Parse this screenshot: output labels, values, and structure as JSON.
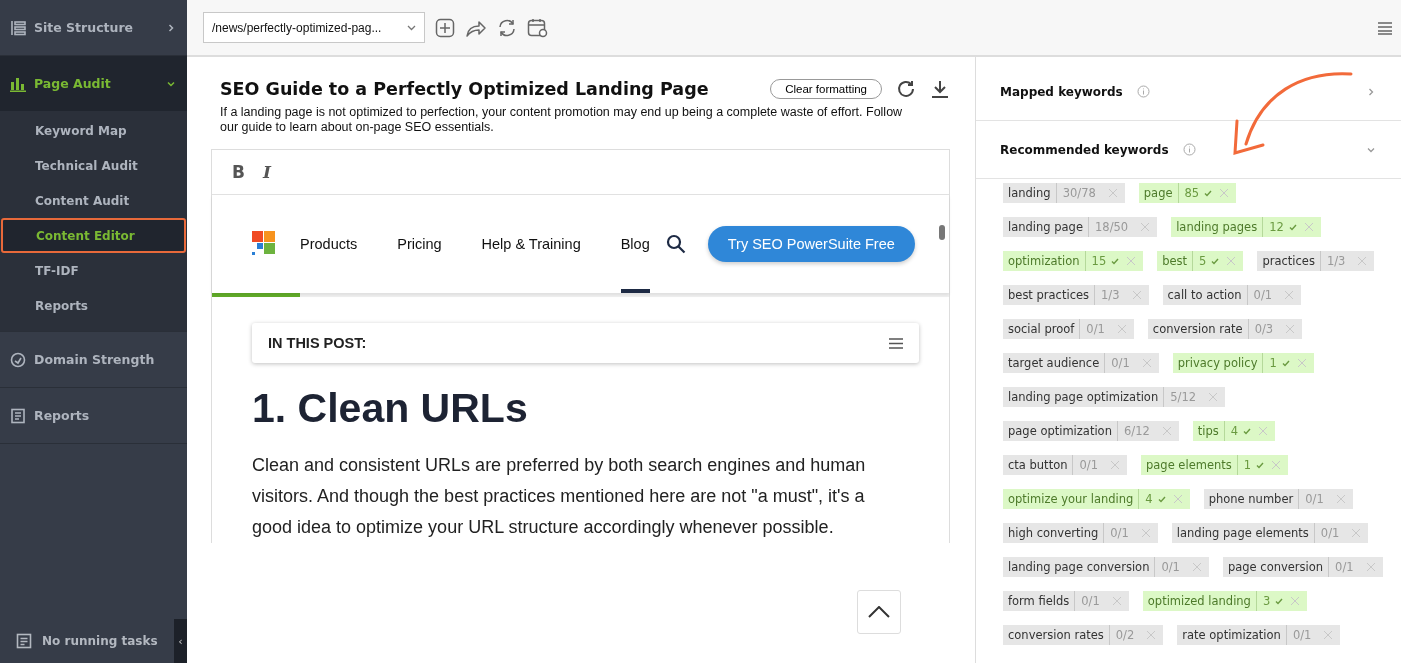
{
  "sidebar": {
    "sections": [
      {
        "label": "Site Structure",
        "expanded": false,
        "selected": false
      },
      {
        "label": "Page Audit",
        "expanded": true,
        "selected": true,
        "children": [
          {
            "label": "Keyword Map",
            "selected": false
          },
          {
            "label": "Technical Audit",
            "selected": false
          },
          {
            "label": "Content Audit",
            "selected": false
          },
          {
            "label": "Content Editor",
            "selected": true
          },
          {
            "label": "TF-IDF",
            "selected": false
          },
          {
            "label": "Reports",
            "selected": false
          }
        ]
      },
      {
        "label": "Domain Strength",
        "selected": false
      },
      {
        "label": "Reports",
        "selected": false
      }
    ],
    "status": "No running tasks",
    "collapse_handle": "‹"
  },
  "toolbar": {
    "url": "/news/perfectly-optimized-pag..."
  },
  "editor": {
    "title": "SEO Guide to a Perfectly Optimized Landing Page",
    "clear_button": "Clear formatting",
    "description": "If a landing page is not optimized to perfection, your content promotion may end up being a complete waste of effort. Follow our guide to learn about on-page SEO essentials.",
    "format_buttons": [
      "B",
      "I"
    ],
    "site_nav": {
      "links": [
        {
          "label": "Products",
          "selected": false
        },
        {
          "label": "Pricing",
          "selected": false
        },
        {
          "label": "Help & Training",
          "selected": false
        },
        {
          "label": "Blog",
          "selected": true
        }
      ],
      "cta": "Try SEO PowerSuite Free",
      "progress": {
        "level": 0.12
      }
    },
    "toc_label": "IN THIS POST:",
    "heading": "1. Clean URLs",
    "paragraph": "Clean and consistent URLs are preferred by both search engines and human visitors. And though the best practices mentioned here are not \"a must\", it's a good idea to optimize your URL structure accordingly whenever possible."
  },
  "panel": {
    "sections": [
      {
        "title": "Mapped keywords",
        "expanded": false
      },
      {
        "title": "Recommended keywords",
        "expanded": true
      }
    ],
    "keyword_rows": [
      [
        {
          "term": "landing",
          "count": "30/78",
          "matched": false
        },
        {
          "term": "page",
          "count": "85",
          "matched": true
        }
      ],
      [
        {
          "term": "landing page",
          "count": "18/50",
          "matched": false
        },
        {
          "term": "landing pages",
          "count": "12",
          "matched": true
        }
      ],
      [
        {
          "term": "optimization",
          "count": "15",
          "matched": true
        },
        {
          "term": "best",
          "count": "5",
          "matched": true
        },
        {
          "term": "practices",
          "count": "1/3",
          "matched": false
        }
      ],
      [
        {
          "term": "best practices",
          "count": "1/3",
          "matched": false
        },
        {
          "term": "call to action",
          "count": "0/1",
          "matched": false
        }
      ],
      [
        {
          "term": "social proof",
          "count": "0/1",
          "matched": false
        },
        {
          "term": "conversion rate",
          "count": "0/3",
          "matched": false
        }
      ],
      [
        {
          "term": "target audience",
          "count": "0/1",
          "matched": false
        },
        {
          "term": "privacy policy",
          "count": "1",
          "matched": true
        }
      ],
      [
        {
          "term": "landing page optimization",
          "count": "5/12",
          "matched": false
        }
      ],
      [
        {
          "term": "page optimization",
          "count": "6/12",
          "matched": false
        },
        {
          "term": "tips",
          "count": "4",
          "matched": true
        }
      ],
      [
        {
          "term": "cta button",
          "count": "0/1",
          "matched": false
        },
        {
          "term": "page elements",
          "count": "1",
          "matched": true
        }
      ],
      [
        {
          "term": "optimize your landing",
          "count": "4",
          "matched": true
        },
        {
          "term": "phone number",
          "count": "0/1",
          "matched": false
        }
      ],
      [
        {
          "term": "high converting",
          "count": "0/1",
          "matched": false
        },
        {
          "term": "landing page elements",
          "count": "0/1",
          "matched": false
        }
      ],
      [
        {
          "term": "landing page conversion",
          "count": "0/1",
          "matched": false
        },
        {
          "term": "page conversion",
          "count": "0/1",
          "matched": false
        }
      ],
      [
        {
          "term": "form fields",
          "count": "0/1",
          "matched": false
        },
        {
          "term": "optimized landing",
          "count": "3",
          "matched": true
        }
      ],
      [
        {
          "term": "conversion rates",
          "count": "0/2",
          "matched": false
        },
        {
          "term": "rate optimization",
          "count": "0/1",
          "matched": false
        }
      ]
    ]
  }
}
